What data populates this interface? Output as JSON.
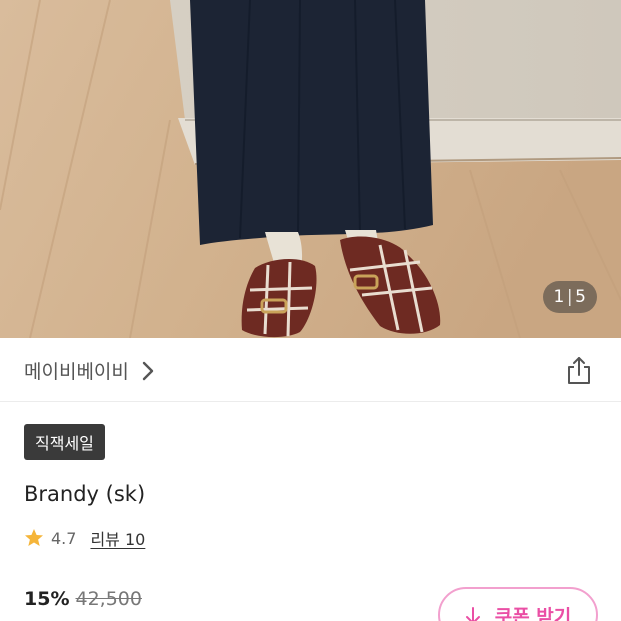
{
  "gallery": {
    "current": "1",
    "separator": "|",
    "total": "5"
  },
  "seller": {
    "name": "메이비베이비"
  },
  "product": {
    "badge": "직잭세일",
    "title": "Brandy (sk)",
    "rating": "4.7",
    "review_label": "리뷰 10",
    "discount": "15%",
    "original_price": "42,500"
  },
  "coupon": {
    "label": "쿠폰 받기"
  },
  "colors": {
    "accent_pink": "#ea4fa5",
    "star": "#f5b53a",
    "badge_bg": "#3a3a3a"
  },
  "icons": [
    "chevron-right-icon",
    "share-icon",
    "star-icon",
    "download-arrow-icon"
  ]
}
